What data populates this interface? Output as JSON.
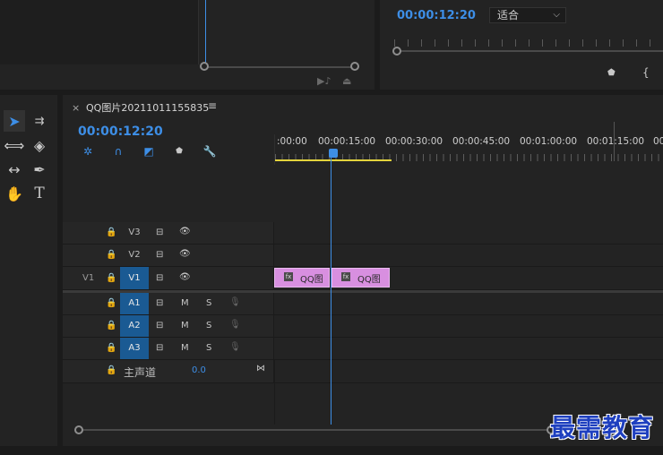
{
  "source_monitor": {},
  "program_monitor": {
    "timecode": "00:00:12:20",
    "fit_value": "适合"
  },
  "timeline": {
    "tab_title": "QQ图片20211011155835",
    "tab_close": "×",
    "tab_menu": "≡",
    "timecode": "00:00:12:20",
    "ruler_labels": [
      ":00:00",
      "00:00:15:00",
      "00:00:30:00",
      "00:00:45:00",
      "00:01:00:00",
      "00:01:15:00",
      "00"
    ],
    "tracks": {
      "v3": "V3",
      "v2": "V2",
      "v1_source": "V1",
      "v1": "V1",
      "a1": "A1",
      "a2": "A2",
      "a3": "A3",
      "mute": "M",
      "solo": "S",
      "master_label": "主声道",
      "master_value": "0.0"
    },
    "clips": [
      {
        "label": "QQ图",
        "fx": "fx"
      },
      {
        "label": "QQ图",
        "fx": "fx"
      }
    ]
  },
  "watermark": "最需教育",
  "colors": {
    "accent": "#3d8ee6",
    "clip": "#d88fe0",
    "work_area": "#e3d33c",
    "target_track": "#1a5a93"
  }
}
